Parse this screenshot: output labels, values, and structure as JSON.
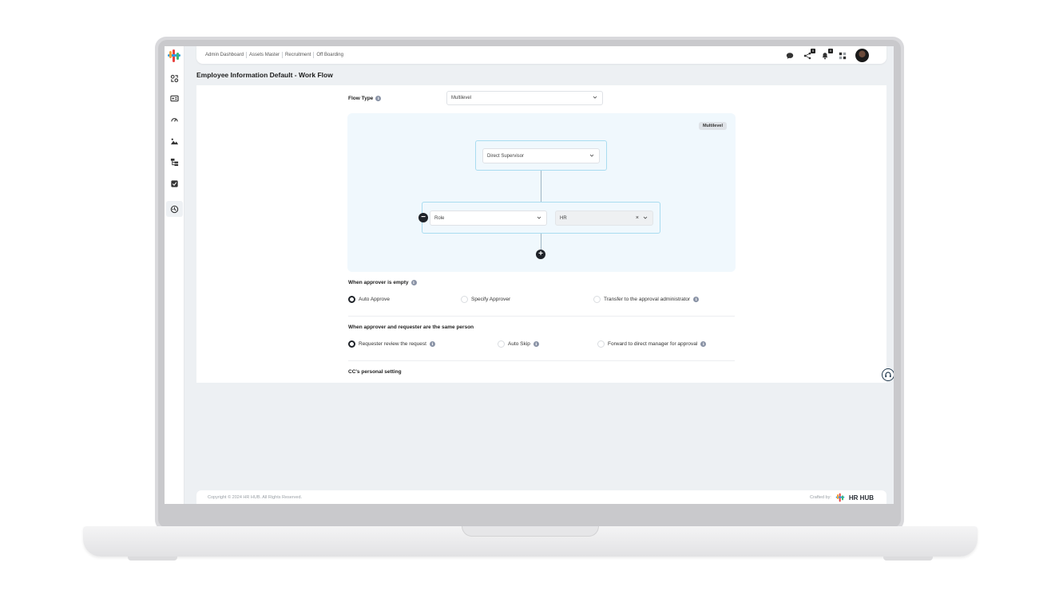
{
  "header": {
    "breadcrumbs": [
      "Admin Dashboard",
      "Assets Master",
      "Recruitment",
      "Off Boarding"
    ],
    "chat_badge": "",
    "share_badge": "0",
    "bell_badge": "0"
  },
  "page": {
    "title": "Employee Information Default - Work Flow"
  },
  "flow_type": {
    "label": "Flow Type",
    "value": "Multilevel"
  },
  "flow": {
    "badge": "Multilevel",
    "first_node": {
      "value": "Direct Supervisor"
    },
    "second_node": {
      "type_value": "Role",
      "value": "HR",
      "clear": "×"
    },
    "remove_symbol": "−",
    "add_symbol": "+"
  },
  "approver_empty": {
    "label": "When approver is empty",
    "options": [
      "Auto Approve",
      "Specify Approver",
      "Transfer to the approval administrator"
    ],
    "selected": "Auto Approve"
  },
  "same_person": {
    "label": "When approver and requester are the same person",
    "options": [
      "Requester review the request",
      "Auto Skip",
      "Forward to direct manager for approval"
    ],
    "selected": "Requester review the request"
  },
  "cc": {
    "label": "CC's personal setting"
  },
  "footer": {
    "copyright": "Copyright © 2024 HR HUB. All Rights Reserved.",
    "crafted_by": "Crafted by:",
    "brand": "HR HUB"
  },
  "colors": {
    "accent": "#1f2329",
    "flow_bg": "#f0f8fd",
    "node_border": "#a9dcf0"
  }
}
